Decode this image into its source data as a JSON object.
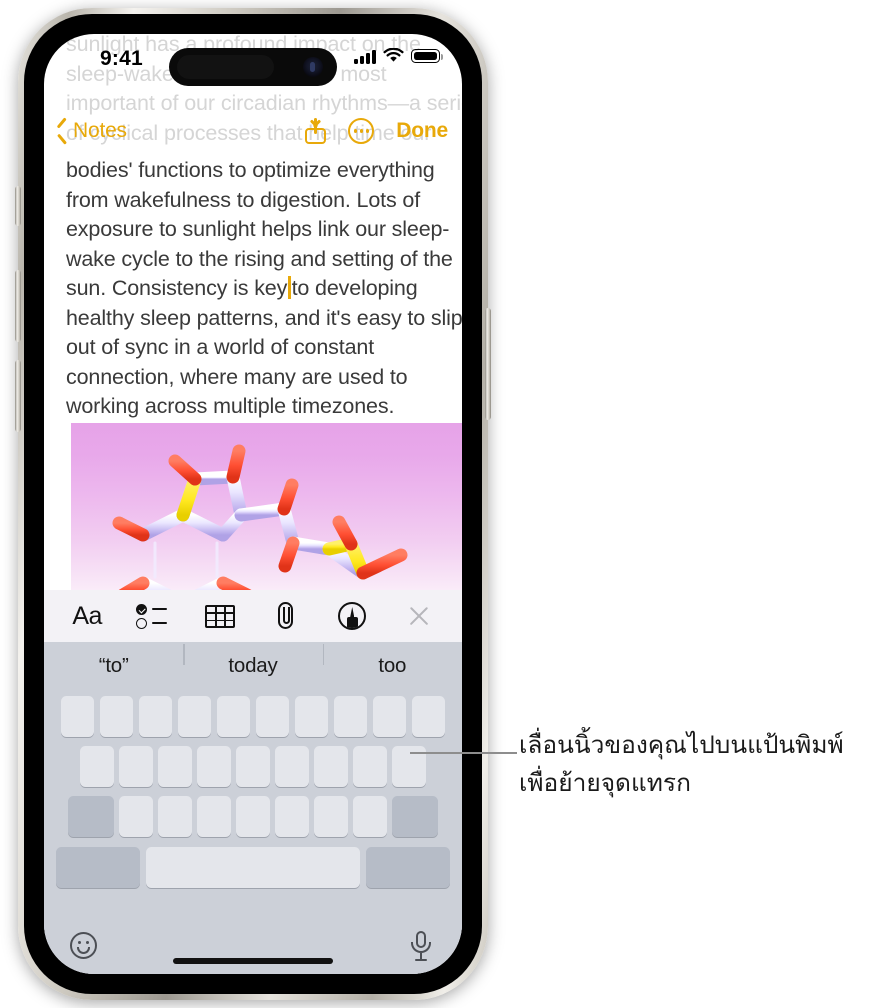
{
  "status_bar": {
    "time": "9:41",
    "signal_icon": "cellular-bars-icon",
    "wifi_icon": "wifi-icon",
    "battery_icon": "battery-full-icon"
  },
  "nav_bar": {
    "back_label": "Notes",
    "back_icon": "chevron-left-icon",
    "share_icon": "share-icon",
    "more_icon": "more-circle-icon",
    "done_label": "Done",
    "accent_color": "#e8a90a"
  },
  "note": {
    "faded_lines": [
      "sunlight has a profound impact on the",
      "sleep-wake cycle, one of the most",
      "important of our circadian rhythms—a series",
      "of cyclical processes that help time our"
    ],
    "lines_before_caret": [
      "bodies' functions to optimize everything",
      "from wakefulness to digestion. Lots of",
      "exposure to sunlight helps link our sleep-",
      "wake cycle to the rising and setting of the"
    ],
    "caret_line_prefix": "sun. Consistency is key",
    "caret_line_suffix": "to developing",
    "lines_after_caret": [
      "healthy sleep patterns, and it's easy to slip",
      "out of sync in a world of constant",
      "connection, where many are used to",
      "working across multiple timezones."
    ],
    "attachment_alt": "molecule-illustration"
  },
  "toolbar": {
    "format_label": "Aa",
    "items": [
      "format-text-icon",
      "checklist-icon",
      "table-icon",
      "attachment-paperclip-icon",
      "markup-pen-icon",
      "close-icon"
    ]
  },
  "predictive_bar": {
    "suggestions": [
      "“to”",
      "today",
      "too"
    ]
  },
  "keyboard": {
    "rows": [
      {
        "keys": 10,
        "type": "letter"
      },
      {
        "keys": 9,
        "type": "letter"
      },
      {
        "keys": 7,
        "type": "letter",
        "left_mod": "shift-key",
        "right_mod": "delete-key"
      },
      {
        "type": "bottom",
        "left": "numbers-key",
        "space": "space-key",
        "right": "return-key"
      }
    ],
    "emoji_icon": "emoji-smiley-icon",
    "dictation_icon": "microphone-icon"
  },
  "callout": {
    "line_1": "เลื่อนนิ้วของคุณไปบนแป้นพิมพ์",
    "line_2": "เพื่อย้ายจุดแทรก"
  }
}
